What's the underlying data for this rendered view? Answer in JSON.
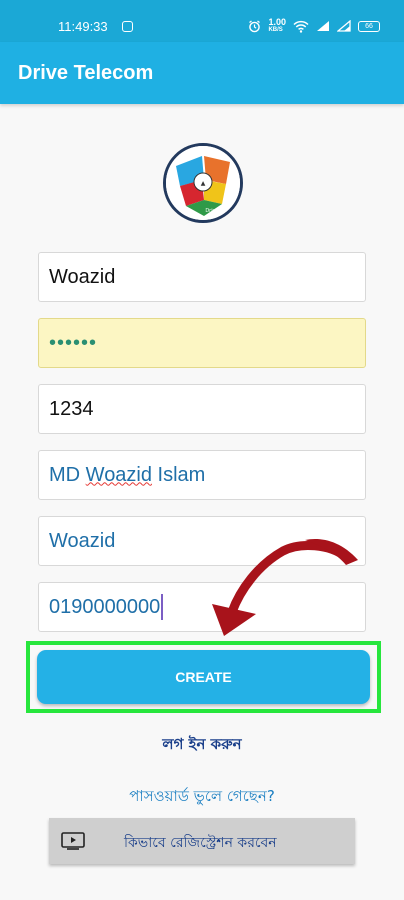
{
  "status_bar": {
    "time": "11:49:33",
    "data_speed": "1.00",
    "data_unit": "KB/S",
    "battery": "66"
  },
  "appbar": {
    "title": "Drive Telecom"
  },
  "form": {
    "username": "Woazid",
    "password": "••••••",
    "pin": "1234",
    "full_name_first": "MD ",
    "full_name_spell": "Woazid",
    "full_name_rest": " Islam",
    "shop_name": "Woazid",
    "phone": "0190000000"
  },
  "create_label": "CREATE",
  "login_link": "লগ ইন করুন",
  "forgot_link": "পাসওয়ার্ড ভুলে গেছেন?",
  "tutorial_label": "কিভাবে রেজিস্ট্রেশন করবেন",
  "colors": {
    "appbar": "#1fb0e3",
    "button": "#24b1e6",
    "highlight": "#27e63d",
    "arrow": "#b0141c"
  },
  "icons": [
    "app-notification-icon",
    "alarm-icon",
    "wifi-icon",
    "signal-icon",
    "battery-icon",
    "video-play-icon",
    "brand-logo",
    "annotation-arrow"
  ]
}
